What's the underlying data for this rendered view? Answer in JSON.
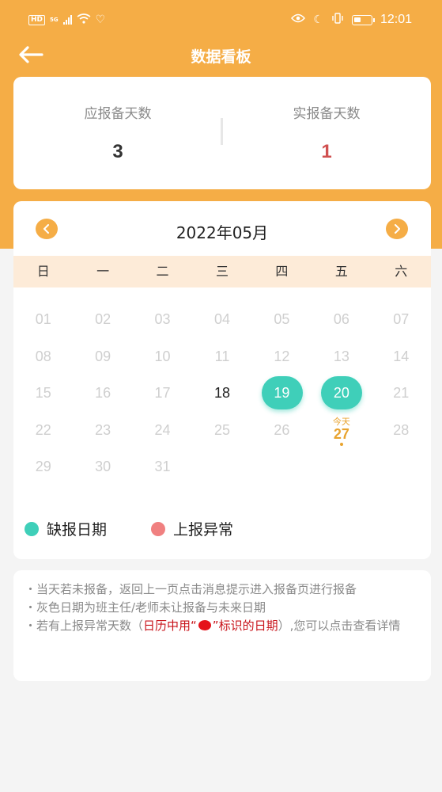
{
  "status_bar": {
    "hd": "HD",
    "network": "5G",
    "time": "12:01"
  },
  "header": {
    "title": "数据看板",
    "back_icon": "back-arrow-icon"
  },
  "summary": {
    "expected_label": "应报备天数",
    "expected_value": "3",
    "actual_label": "实报备天数",
    "actual_value": "1",
    "actual_color": "#d05050"
  },
  "calendar": {
    "month_title": "2022年05月",
    "weekdays": [
      "日",
      "一",
      "二",
      "三",
      "四",
      "五",
      "六"
    ],
    "today_label": "今天",
    "days": [
      "01",
      "02",
      "03",
      "04",
      "05",
      "06",
      "07",
      "08",
      "09",
      "10",
      "11",
      "12",
      "13",
      "14",
      "15",
      "16",
      "17",
      "18",
      "19",
      "20",
      "21",
      "22",
      "23",
      "24",
      "25",
      "26",
      "27",
      "28",
      "29",
      "30",
      "31"
    ],
    "active_days": [
      "18"
    ],
    "missed_days": [
      "19",
      "20"
    ],
    "today": "27"
  },
  "legend": {
    "missed_label": "缺报日期",
    "missed_color": "#3fcfb9",
    "abnormal_label": "上报异常",
    "abnormal_color": "#f08080"
  },
  "notes": {
    "line1": "・当天若未报备，返回上一页点击消息提示进入报备页进行报备",
    "line2": "・灰色日期为班主任/老师未让报备与未来日期",
    "line3_prefix": "・若有上报异常天数（",
    "line3_red_a": "日历中用“",
    "line3_red_b": "”标识的日期",
    "line3_suffix": "）,您可以点击查看详情"
  },
  "colors": {
    "brand": "#f5ad46",
    "weekday_bg": "#fdebd8",
    "today": "#e8a32e"
  }
}
